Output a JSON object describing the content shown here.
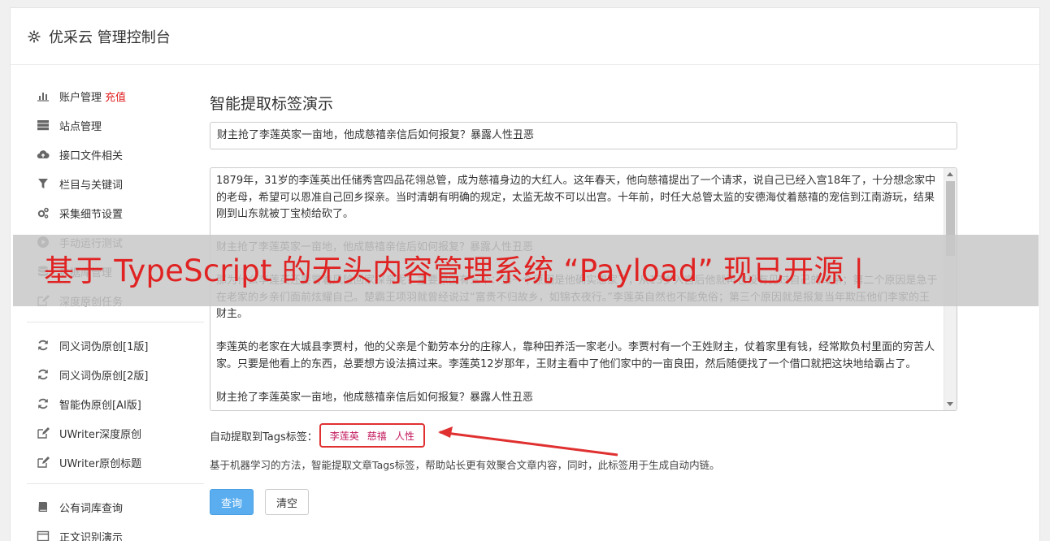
{
  "header": {
    "title": "优采云 管理控制台",
    "icon": "gear-icon"
  },
  "sidebar": {
    "group1": [
      {
        "label": "账户管理",
        "badge": "充值",
        "icon": "bar-chart-icon"
      },
      {
        "label": "站点管理",
        "icon": "server-icon"
      },
      {
        "label": "接口文件相关",
        "icon": "cloud-upload-icon"
      },
      {
        "label": "栏目与关键词",
        "icon": "filter-icon"
      },
      {
        "label": "采集细节设置",
        "icon": "cogs-icon"
      },
      {
        "label": "手动运行测试",
        "icon": "play-circle-icon"
      },
      {
        "label": "数据库管理",
        "icon": "database-icon"
      },
      {
        "label": "深度原创任务",
        "icon": "edit-icon"
      }
    ],
    "group2": [
      {
        "label": "同义词伪原创[1版]",
        "icon": "refresh-icon"
      },
      {
        "label": "同义词伪原创[2版]",
        "icon": "refresh-icon"
      },
      {
        "label": "智能伪原创[AI版]",
        "icon": "refresh-icon"
      },
      {
        "label": "UWriter深度原创",
        "icon": "edit-icon"
      },
      {
        "label": "UWriter原创标题",
        "icon": "edit-icon"
      }
    ],
    "group3": [
      {
        "label": "公有词库查询",
        "icon": "book-icon"
      },
      {
        "label": "正文识别演示",
        "icon": "window-icon"
      }
    ]
  },
  "main": {
    "heading": "智能提取标签演示",
    "title_value": "财主抢了李莲英家一亩地，他成慈禧亲信后如何报复？暴露人性丑恶",
    "content_value": "1879年，31岁的李莲英出任储秀宫四品花翎总管，成为慈禧身边的大红人。这年春天，他向慈禧提出了一个请求，说自己已经入宫18年了，十分想念家中的老母，希望可以恩准自己回乡探亲。当时清朝有明确的规定，太监无故不可以出宫。十年前，时任大总管太监的安德海仗着慈禧的宠信到江南游玩，结果刚到山东就被丁宝桢给砍了。\n\n财主抢了李莲英家一亩地，他成慈禧亲信后如何报复？暴露人性丑恶\n\n那为什么李莲英还要冒着风险回家探亲呢？主要原因有三个：第一个原因是他确实想家了，从13岁入宫后他就再也没有见过自己的母亲；第二个原因是急于在老家的乡亲们面前炫耀自己。楚霸王项羽就曾经说过“富贵不归故乡，如锦衣夜行。”李莲英自然也不能免俗；第三个原因就是报复当年欺压他们李家的王财主。\n\n李莲英的老家在大城县李贾村，他的父亲是个勤劳本分的庄稼人，靠种田养活一家老小。李贾村有一个王姓财主，仗着家里有钱，经常欺负村里面的穷苦人家。只要是他看上的东西，总要想方设法搞过来。李莲英12岁那年，王财主看中了他们家中的一亩良田，然后随便找了一个借口就把这块地给霸占了。\n\n财主抢了李莲英家一亩地，他成慈禧亲信后如何报复？暴露人性丑恶",
    "tags_label": "自动提取到Tags标签：",
    "tags": [
      "李莲英",
      "慈禧",
      "人性"
    ],
    "description": "基于机器学习的方法，智能提取文章Tags标签，帮助站长更有效聚合文章内容，同时，此标签用于生成自动内链。",
    "query_button": "查询",
    "clear_button": "清空"
  },
  "overlay": {
    "text": "基于 TypeScript 的无头内容管理系统 “Payload” 现已开源 |"
  },
  "colors": {
    "accent_button": "#5aaef0",
    "tag_color": "#c2185b",
    "highlight_red": "#e03030",
    "badge_red": "#e02020",
    "overlay_text": "#e02222"
  }
}
